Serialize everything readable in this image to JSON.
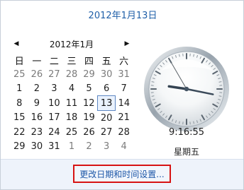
{
  "header": {
    "date_text": "2012年1月13日"
  },
  "calendar": {
    "month_label": "2012年1月",
    "prev_icon": "left-triangle-icon",
    "next_icon": "right-triangle-icon",
    "weekdays": [
      "日",
      "一",
      "二",
      "三",
      "四",
      "五",
      "六"
    ],
    "days": [
      {
        "text": "25",
        "current": false,
        "selected": false
      },
      {
        "text": "26",
        "current": false,
        "selected": false
      },
      {
        "text": "27",
        "current": false,
        "selected": false
      },
      {
        "text": "28",
        "current": false,
        "selected": false
      },
      {
        "text": "29",
        "current": false,
        "selected": false
      },
      {
        "text": "30",
        "current": false,
        "selected": false
      },
      {
        "text": "31",
        "current": false,
        "selected": false
      },
      {
        "text": "1",
        "current": true,
        "selected": false
      },
      {
        "text": "2",
        "current": true,
        "selected": false
      },
      {
        "text": "3",
        "current": true,
        "selected": false
      },
      {
        "text": "4",
        "current": true,
        "selected": false
      },
      {
        "text": "5",
        "current": true,
        "selected": false
      },
      {
        "text": "6",
        "current": true,
        "selected": false
      },
      {
        "text": "7",
        "current": true,
        "selected": false
      },
      {
        "text": "8",
        "current": true,
        "selected": false
      },
      {
        "text": "9",
        "current": true,
        "selected": false
      },
      {
        "text": "10",
        "current": true,
        "selected": false
      },
      {
        "text": "11",
        "current": true,
        "selected": false
      },
      {
        "text": "12",
        "current": true,
        "selected": false
      },
      {
        "text": "13",
        "current": true,
        "selected": true
      },
      {
        "text": "14",
        "current": true,
        "selected": false
      },
      {
        "text": "15",
        "current": true,
        "selected": false
      },
      {
        "text": "16",
        "current": true,
        "selected": false
      },
      {
        "text": "17",
        "current": true,
        "selected": false
      },
      {
        "text": "18",
        "current": true,
        "selected": false
      },
      {
        "text": "19",
        "current": true,
        "selected": false
      },
      {
        "text": "20",
        "current": true,
        "selected": false
      },
      {
        "text": "21",
        "current": true,
        "selected": false
      },
      {
        "text": "22",
        "current": true,
        "selected": false
      },
      {
        "text": "23",
        "current": true,
        "selected": false
      },
      {
        "text": "24",
        "current": true,
        "selected": false
      },
      {
        "text": "25",
        "current": true,
        "selected": false
      },
      {
        "text": "26",
        "current": true,
        "selected": false
      },
      {
        "text": "27",
        "current": true,
        "selected": false
      },
      {
        "text": "28",
        "current": true,
        "selected": false
      },
      {
        "text": "29",
        "current": true,
        "selected": false
      },
      {
        "text": "30",
        "current": true,
        "selected": false
      },
      {
        "text": "31",
        "current": true,
        "selected": false
      },
      {
        "text": "1",
        "current": false,
        "selected": false
      },
      {
        "text": "2",
        "current": false,
        "selected": false
      },
      {
        "text": "3",
        "current": false,
        "selected": false
      },
      {
        "text": "4",
        "current": false,
        "selected": false
      }
    ]
  },
  "clock": {
    "time_text": "9:16:55",
    "weekday_text": "星期五",
    "hours": 9,
    "minutes": 16,
    "seconds": 55,
    "icon": "analog-clock-icon"
  },
  "footer": {
    "link_text": "更改日期和时间设置...",
    "highlight_color": "#d71313"
  },
  "colors": {
    "date_header": "#1f5fa8",
    "selected_day_border": "#5d87c2",
    "link": "#1d57a8"
  }
}
